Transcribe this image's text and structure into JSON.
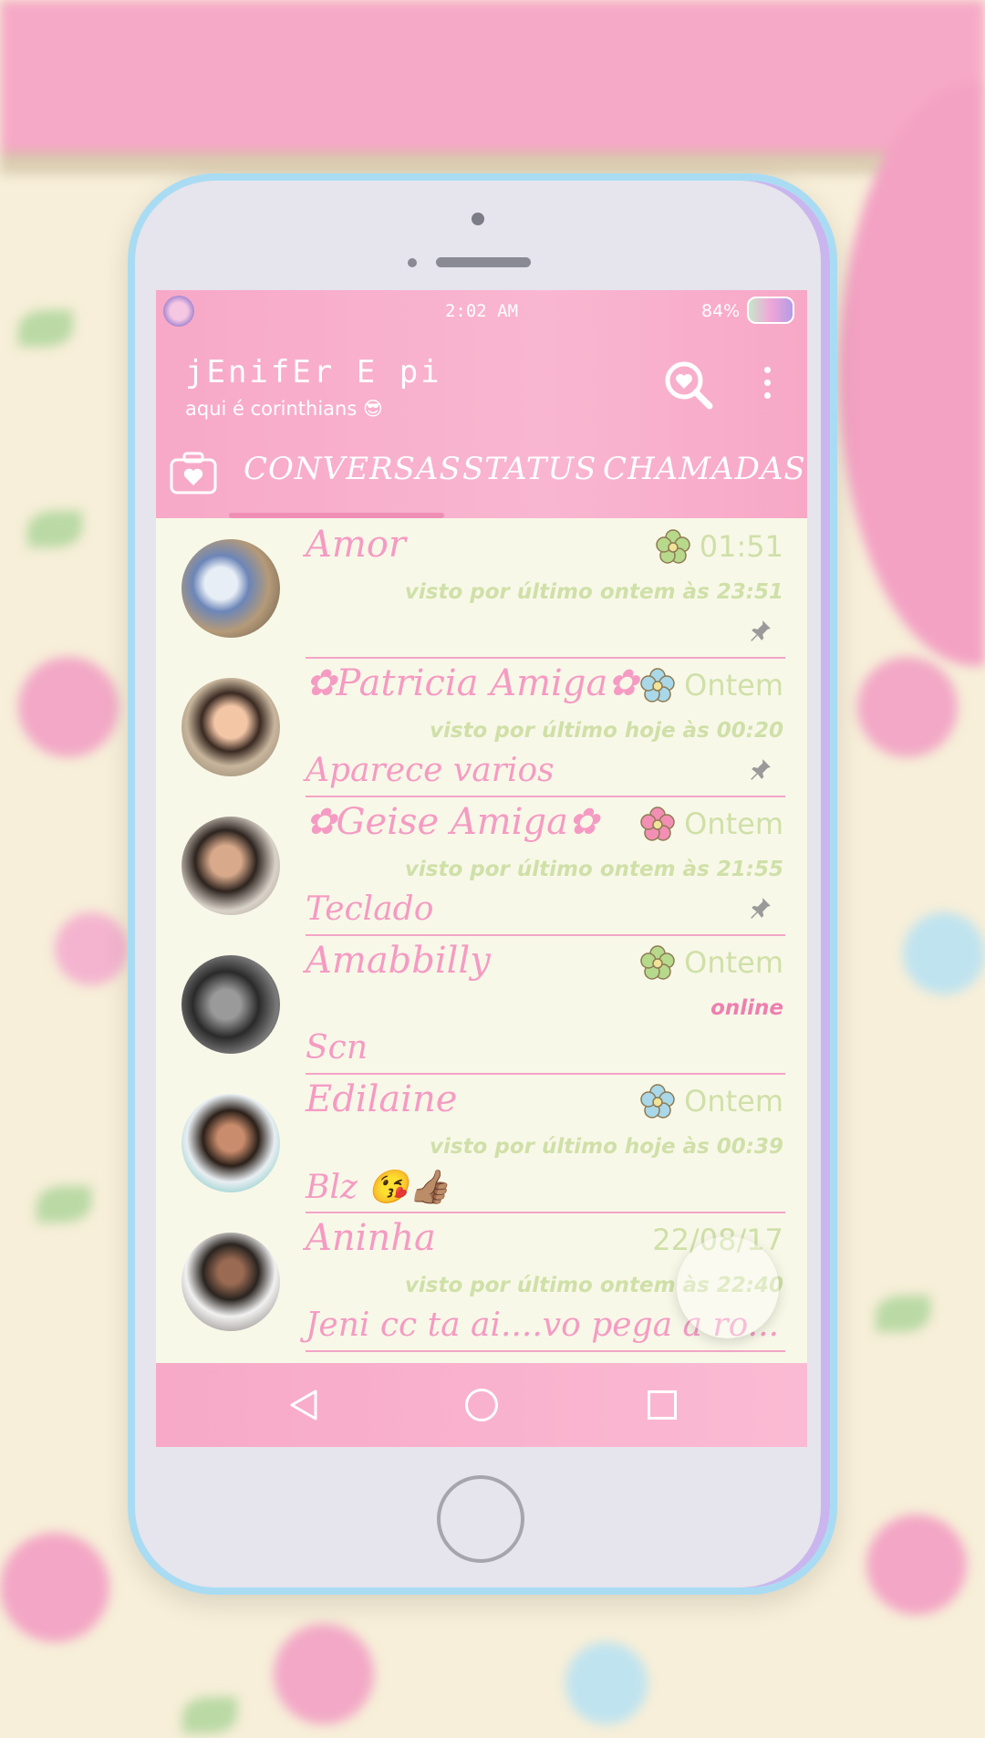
{
  "status_bar": {
    "time": "2:02 AM",
    "battery": "84%"
  },
  "header": {
    "title": "jEnifEr E pi",
    "subtitle": "aqui é corinthians 😎"
  },
  "icons": {
    "search": "search-heart-icon",
    "menu": "more-vert-icon",
    "camera": "camera-icon"
  },
  "tabs": [
    {
      "label": "CONVERSAS",
      "selected": true
    },
    {
      "label": "STATUS",
      "selected": false
    },
    {
      "label": "CHAMADAS",
      "selected": false
    }
  ],
  "chats": [
    {
      "name": "Amor",
      "time": "01:51",
      "status": "visto por último ontem às 23:51",
      "message": "",
      "pinned": true,
      "flower_color": "#b7d98c"
    },
    {
      "name": "✿Patricia Amiga✿",
      "time": "Ontem",
      "status": "visto por último hoje às 00:20",
      "message": "Aparece varios",
      "pinned": true,
      "flower_color": "#a9d8ea"
    },
    {
      "name": "✿Geise Amiga✿",
      "time": "Ontem",
      "status": "visto por último ontem às 21:55",
      "message": "Teclado",
      "pinned": true,
      "flower_color": "#f38fb4"
    },
    {
      "name": "Amabbilly",
      "time": "Ontem",
      "status": "online",
      "message": "Scn",
      "pinned": false,
      "flower_color": "#b7d98c"
    },
    {
      "name": "Edilaine",
      "time": "Ontem",
      "status": "visto por último hoje às 00:39",
      "message": "Blz 😘👍🏽",
      "pinned": false,
      "flower_color": "#a9d8ea"
    },
    {
      "name": "Aninha",
      "time": "22/08/17",
      "status": "visto por último ontem às 22:40",
      "message": "Jeni cc ta ai....vo pega a ro...",
      "pinned": false,
      "flower_color": ""
    }
  ],
  "colors": {
    "accent_pink": "#f7a9c7",
    "text_pink": "#f59bc3",
    "muted_green": "#cfe0a8",
    "screen_bg": "#f8f8e8",
    "phone_border": "#a9dcf3"
  }
}
